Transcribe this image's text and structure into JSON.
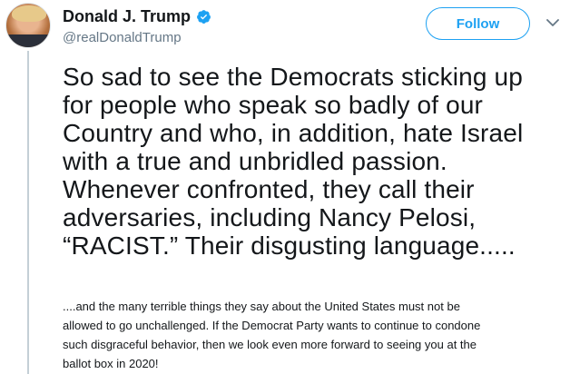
{
  "author": {
    "name": "Donald J. Trump",
    "handle": "@realDonaldTrump",
    "verified_icon": "verified-badge-icon",
    "accent": "#1da1f2"
  },
  "actions": {
    "follow_label": "Follow",
    "menu_icon": "chevron-down-icon"
  },
  "tweet": {
    "text": "So sad to see the Democrats sticking up\nfor people who speak so badly of our\nCountry and who, in addition, hate Israel\nwith a true and unbridled passion.\nWhenever confronted, they call their\nadversaries, including Nancy Pelosi,\n“RACIST.” Their disgusting language.....",
    "reply_text": "....and the many terrible things they say about the United States must not be\nallowed to go unchallenged. If the Democrat Party wants to continue to condone\nsuch disgraceful behavior, then we look even more forward to seeing you at the\nballot box in 2020!"
  }
}
